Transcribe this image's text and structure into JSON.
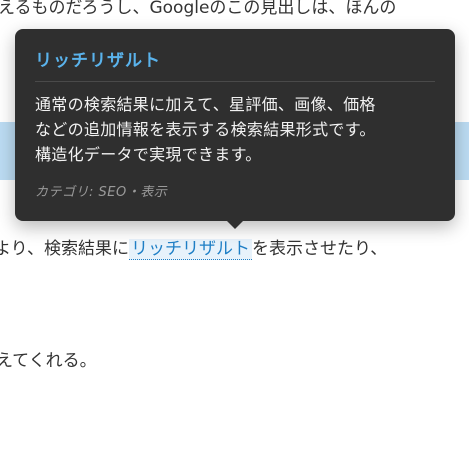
{
  "article": {
    "line1": "えるものだろうし、Googleのこの見出しは、ほんの",
    "line2_before": "より、検索結果に",
    "line2_term": "リッチリザルト",
    "line2_after": "を表示させたり、",
    "line3": "えてくれる。"
  },
  "tooltip": {
    "title": "リッチリザルト",
    "body_line1": "通常の検索結果に加えて、星評価、画像、価格",
    "body_line2": "などの追加情報を表示する検索結果形式です。",
    "body_line3": "構造化データで実現できます。",
    "meta": "カテゴリ: SEO・表示"
  },
  "colors": {
    "tooltip_bg": "#2f2f2f",
    "tooltip_title": "#5ab3ec",
    "link": "#1f7fc6",
    "highlight_band": "#bcdcf3"
  }
}
